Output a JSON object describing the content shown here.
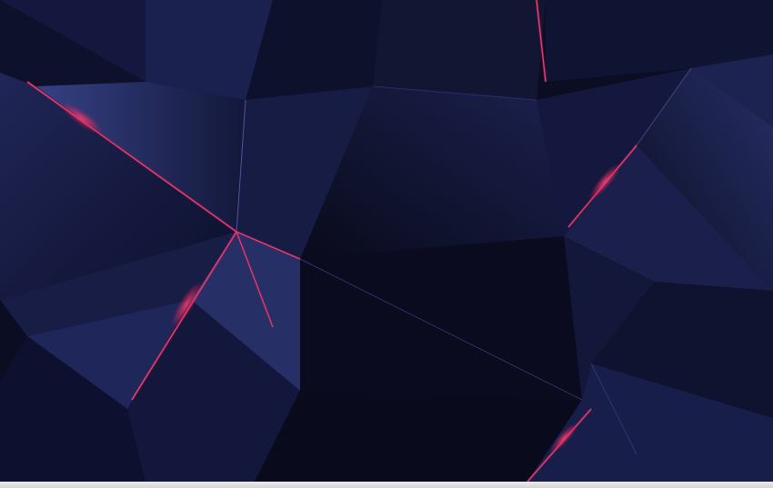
{
  "wallpaper": {
    "description_colors": {
      "base": "#0d1026",
      "facet_dark": "#0b0d22",
      "facet_mid": "#1b2250",
      "facet_light": "#39458a",
      "accent_glow": "#ff1a5c"
    }
  }
}
